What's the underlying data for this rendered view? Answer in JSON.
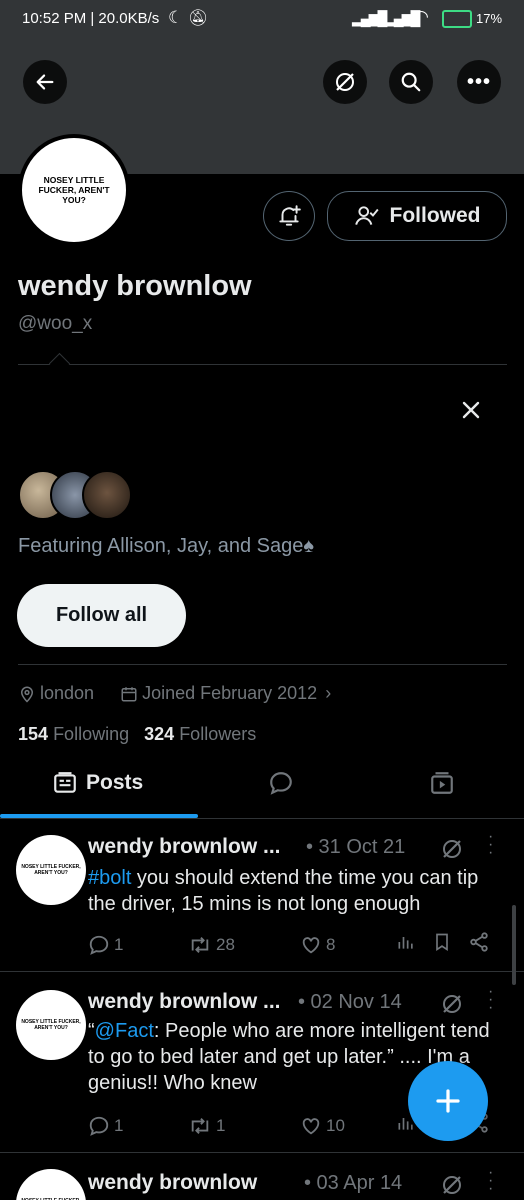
{
  "status": {
    "time": "10:52 PM | 20.0KB/s",
    "battery": "17%"
  },
  "profile": {
    "avatar_text": "NOSEY LITTLE FUCKER, AREN'T YOU?",
    "name": "wendy brownlow",
    "handle": "@woo_x",
    "follow_state": "Followed",
    "location": "london",
    "joined": "Joined February 2012",
    "following_count": "154",
    "following_label": "Following",
    "followers_count": "324",
    "followers_label": "Followers"
  },
  "suggestions": {
    "text": "Featuring Allison, Jay, and Sage",
    "follow_all": "Follow all"
  },
  "tabs": {
    "posts": "Posts"
  },
  "tweets": [
    {
      "name": "wendy brownlow ...",
      "date": "• 31 Oct 21",
      "hashtag": "#bolt",
      "text": " you should extend the time you can tip the driver, 15 mins is not long enough",
      "replies": "1",
      "retweets": "28",
      "likes": "8"
    },
    {
      "name": "wendy brownlow ...",
      "date": "• 02 Nov 14",
      "prefix": "“",
      "mention": "@Fact",
      "text": ": People who are more intelligent tend to go to bed later and get up later.” .... I'm a genius!! Who knew",
      "replies": "1",
      "retweets": "1",
      "likes": "10"
    },
    {
      "name": "wendy brownlow",
      "date": "• 03 Apr 14"
    }
  ],
  "colors": {
    "accent": "#1d9bf0",
    "banner": "#323537",
    "muted": "#71767b"
  }
}
